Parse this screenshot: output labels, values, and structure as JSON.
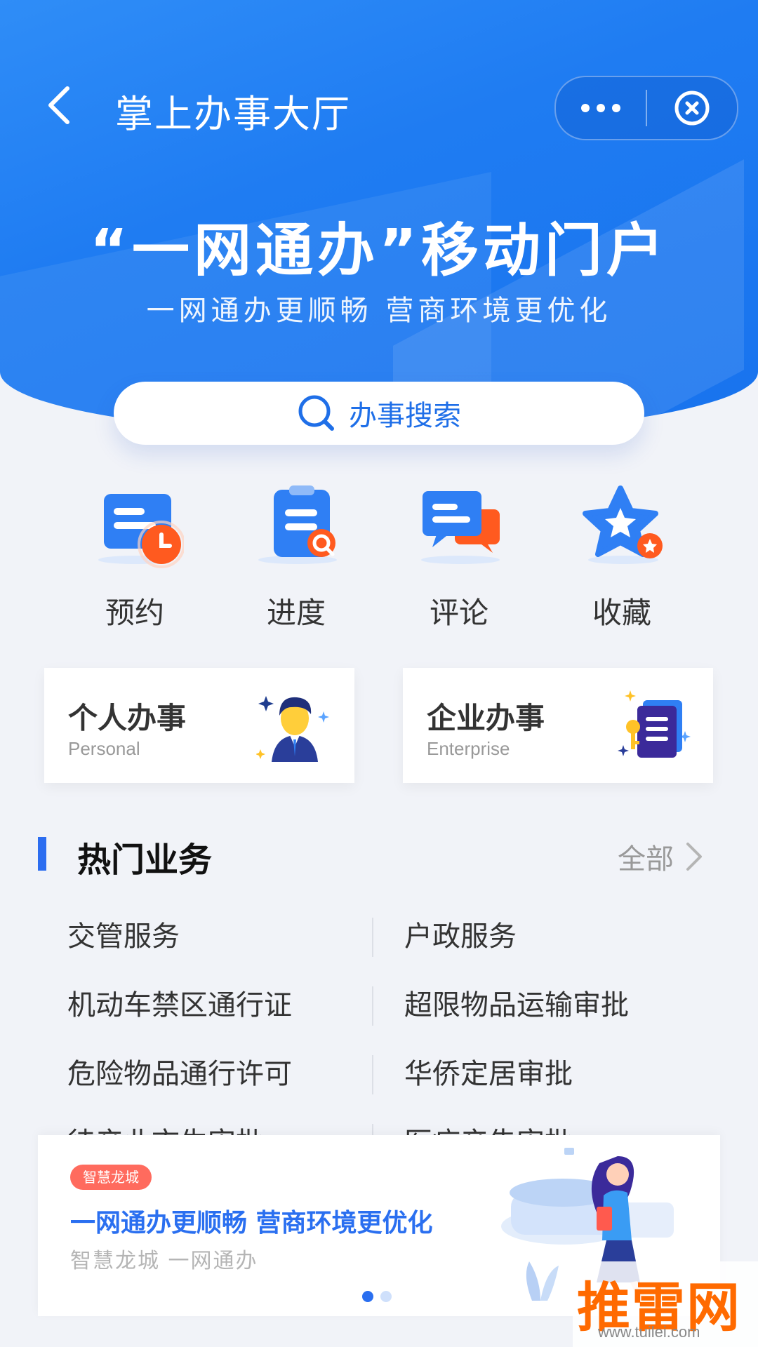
{
  "header": {
    "title": "掌上办事大厅",
    "back_icon": "chevron-left-icon",
    "more_icon": "more-dots-icon",
    "close_icon": "close-circle-icon"
  },
  "banner": {
    "title": "“一网通办”移动门户",
    "subtitle": "一网通办更顺畅 营商环境更优化"
  },
  "search": {
    "placeholder": "办事搜索",
    "icon": "search-icon"
  },
  "quick_actions": [
    {
      "label": "预约",
      "icon": "appointment-icon"
    },
    {
      "label": "进度",
      "icon": "progress-icon"
    },
    {
      "label": "评论",
      "icon": "comment-icon"
    },
    {
      "label": "收藏",
      "icon": "favorite-icon"
    }
  ],
  "service_cards": [
    {
      "title": "个人办事",
      "subtitle": "Personal",
      "icon": "person-icon"
    },
    {
      "title": "企业办事",
      "subtitle": "Enterprise",
      "icon": "document-icon"
    }
  ],
  "hot_section": {
    "title": "热门业务",
    "more_label": "全部"
  },
  "hot_items": [
    [
      "交管服务",
      "户政服务"
    ],
    [
      "机动车禁区通行证",
      "超限物品运输审批"
    ],
    [
      "危险物品通行许可",
      "华侨定居审批"
    ],
    [
      "待产业市生审批",
      "医疗产告审批"
    ]
  ],
  "promo": {
    "tag": "智慧龙城",
    "title": "一网通办更顺畅 营商环境更优化",
    "subtitle": "智慧龙城 一网通办",
    "active_slide": 1,
    "slide_count": 2
  },
  "watermark": {
    "text": "推雷网",
    "url": "www.tuilei.com"
  },
  "colors": {
    "primary": "#1f7cf2",
    "accent": "#2a6ff0",
    "orange": "#ff5a1f",
    "tag_red": "#ff6b5e",
    "page_bg": "#f1f3f8"
  }
}
